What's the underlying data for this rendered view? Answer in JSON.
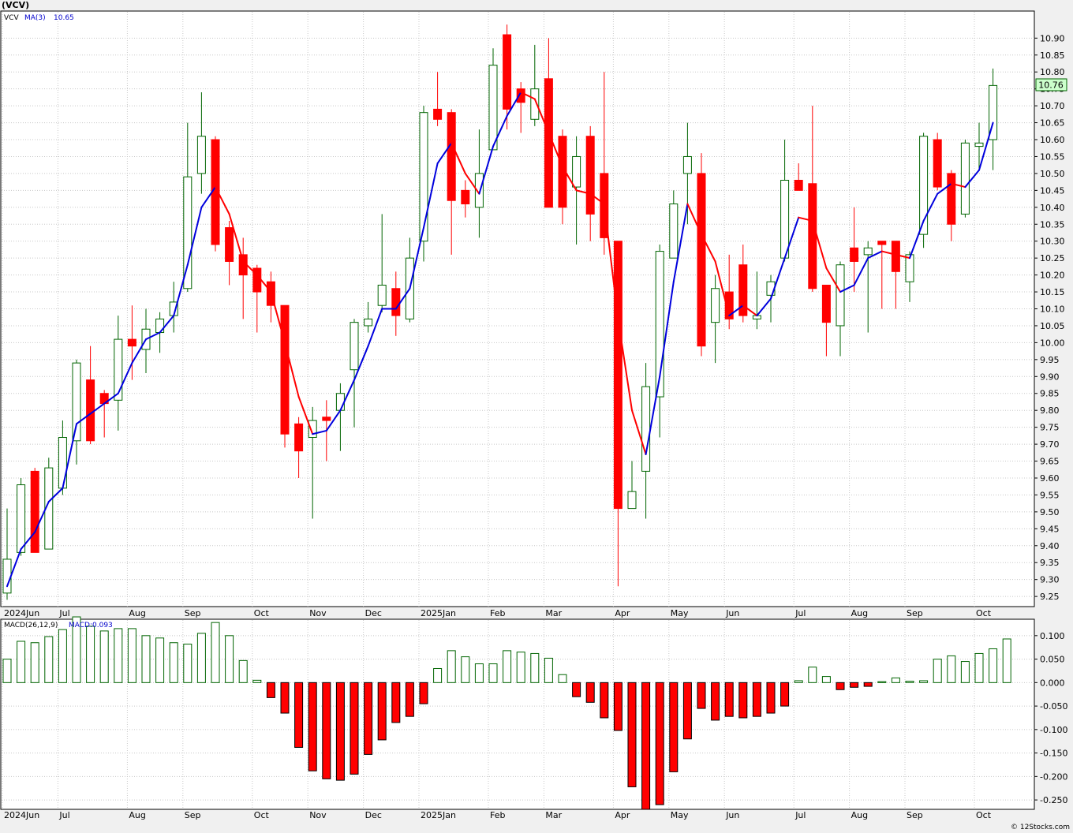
{
  "header": {
    "symbol_title": "(VCV)",
    "legend_symbol": "VCV",
    "ma_label": "MA(3)",
    "ma_value": "10.65",
    "last_price_badge": "10.76",
    "macd_label": "MACD(26,12,9)",
    "macd_value_label": "MACD:0.093",
    "watermark": "© 12Stocks.com"
  },
  "colors": {
    "up": "#006400",
    "down": "#ff0000",
    "ma_up": "#0000dd",
    "ma_down": "#ff0000",
    "grid": "#c8c8c8",
    "badge_bg": "#ccffcc",
    "legend_text": "#0000cc"
  },
  "chart_data": [
    {
      "type": "candlestick",
      "title": "",
      "ylim": [
        9.22,
        10.98
      ],
      "yticks": [
        "10.90",
        "10.85",
        "10.80",
        "10.75",
        "10.70",
        "10.65",
        "10.60",
        "10.55",
        "10.50",
        "10.45",
        "10.40",
        "10.35",
        "10.30",
        "10.25",
        "10.20",
        "10.15",
        "10.10",
        "10.05",
        "10.00",
        "9.95",
        "9.90",
        "9.85",
        "9.80",
        "9.75",
        "9.70",
        "9.65",
        "9.60",
        "9.55",
        "9.50",
        "9.45",
        "9.40",
        "9.35",
        "9.30",
        "9.25"
      ],
      "xticks": [
        {
          "label": "2024Jun",
          "bar": 0
        },
        {
          "label": "Jul",
          "bar": 4
        },
        {
          "label": "Aug",
          "bar": 9
        },
        {
          "label": "Sep",
          "bar": 13
        },
        {
          "label": "Oct",
          "bar": 18
        },
        {
          "label": "Nov",
          "bar": 22
        },
        {
          "label": "Dec",
          "bar": 26
        },
        {
          "label": "2025Jan",
          "bar": 30
        },
        {
          "label": "Feb",
          "bar": 35
        },
        {
          "label": "Mar",
          "bar": 39
        },
        {
          "label": "Apr",
          "bar": 44
        },
        {
          "label": "May",
          "bar": 48
        },
        {
          "label": "Jun",
          "bar": 52
        },
        {
          "label": "Jul",
          "bar": 57
        },
        {
          "label": "Aug",
          "bar": 61
        },
        {
          "label": "Sep",
          "bar": 65
        },
        {
          "label": "Oct",
          "bar": 70
        }
      ],
      "candles": [
        {
          "o": 9.26,
          "h": 9.51,
          "l": 9.24,
          "c": 9.36
        },
        {
          "o": 9.38,
          "h": 9.6,
          "l": 9.37,
          "c": 9.58
        },
        {
          "o": 9.62,
          "h": 9.63,
          "l": 9.38,
          "c": 9.38
        },
        {
          "o": 9.39,
          "h": 9.66,
          "l": 9.39,
          "c": 9.63
        },
        {
          "o": 9.57,
          "h": 9.77,
          "l": 9.55,
          "c": 9.72
        },
        {
          "o": 9.71,
          "h": 9.95,
          "l": 9.64,
          "c": 9.94
        },
        {
          "o": 9.89,
          "h": 9.99,
          "l": 9.7,
          "c": 9.71
        },
        {
          "o": 9.85,
          "h": 9.86,
          "l": 9.72,
          "c": 9.82
        },
        {
          "o": 9.83,
          "h": 10.08,
          "l": 9.74,
          "c": 10.01
        },
        {
          "o": 10.01,
          "h": 10.11,
          "l": 9.89,
          "c": 9.99
        },
        {
          "o": 9.98,
          "h": 10.1,
          "l": 9.91,
          "c": 10.04
        },
        {
          "o": 10.03,
          "h": 10.09,
          "l": 9.97,
          "c": 10.07
        },
        {
          "o": 10.08,
          "h": 10.18,
          "l": 10.03,
          "c": 10.12
        },
        {
          "o": 10.16,
          "h": 10.65,
          "l": 10.15,
          "c": 10.49
        },
        {
          "o": 10.5,
          "h": 10.74,
          "l": 10.44,
          "c": 10.61
        },
        {
          "o": 10.6,
          "h": 10.61,
          "l": 10.27,
          "c": 10.29
        },
        {
          "o": 10.34,
          "h": 10.36,
          "l": 10.17,
          "c": 10.24
        },
        {
          "o": 10.26,
          "h": 10.31,
          "l": 10.07,
          "c": 10.2
        },
        {
          "o": 10.22,
          "h": 10.23,
          "l": 10.03,
          "c": 10.15
        },
        {
          "o": 10.18,
          "h": 10.21,
          "l": 10.06,
          "c": 10.11
        },
        {
          "o": 10.11,
          "h": 10.11,
          "l": 9.69,
          "c": 9.73
        },
        {
          "o": 9.76,
          "h": 9.78,
          "l": 9.6,
          "c": 9.68
        },
        {
          "o": 9.72,
          "h": 9.81,
          "l": 9.48,
          "c": 9.77
        },
        {
          "o": 9.78,
          "h": 9.83,
          "l": 9.65,
          "c": 9.77
        },
        {
          "o": 9.8,
          "h": 9.88,
          "l": 9.68,
          "c": 9.85
        },
        {
          "o": 9.92,
          "h": 10.07,
          "l": 9.75,
          "c": 10.06
        },
        {
          "o": 10.05,
          "h": 10.12,
          "l": 10.03,
          "c": 10.07
        },
        {
          "o": 10.11,
          "h": 10.38,
          "l": 10.09,
          "c": 10.17
        },
        {
          "o": 10.16,
          "h": 10.21,
          "l": 10.02,
          "c": 10.08
        },
        {
          "o": 10.07,
          "h": 10.31,
          "l": 10.06,
          "c": 10.25
        },
        {
          "o": 10.3,
          "h": 10.7,
          "l": 10.24,
          "c": 10.68
        },
        {
          "o": 10.69,
          "h": 10.8,
          "l": 10.64,
          "c": 10.66
        },
        {
          "o": 10.68,
          "h": 10.69,
          "l": 10.26,
          "c": 10.42
        },
        {
          "o": 10.45,
          "h": 10.48,
          "l": 10.37,
          "c": 10.41
        },
        {
          "o": 10.4,
          "h": 10.63,
          "l": 10.31,
          "c": 10.5
        },
        {
          "o": 10.57,
          "h": 10.87,
          "l": 10.57,
          "c": 10.82
        },
        {
          "o": 10.91,
          "h": 10.94,
          "l": 10.63,
          "c": 10.69
        },
        {
          "o": 10.75,
          "h": 10.77,
          "l": 10.62,
          "c": 10.71
        },
        {
          "o": 10.66,
          "h": 10.88,
          "l": 10.64,
          "c": 10.75
        },
        {
          "o": 10.78,
          "h": 10.9,
          "l": 10.45,
          "c": 10.4
        },
        {
          "o": 10.61,
          "h": 10.63,
          "l": 10.35,
          "c": 10.4
        },
        {
          "o": 10.46,
          "h": 10.61,
          "l": 10.29,
          "c": 10.55
        },
        {
          "o": 10.61,
          "h": 10.64,
          "l": 10.3,
          "c": 10.38
        },
        {
          "o": 10.5,
          "h": 10.8,
          "l": 10.26,
          "c": 10.31
        },
        {
          "o": 10.3,
          "h": 10.3,
          "l": 9.28,
          "c": 9.51
        },
        {
          "o": 9.51,
          "h": 9.65,
          "l": 9.51,
          "c": 9.56
        },
        {
          "o": 9.62,
          "h": 9.94,
          "l": 9.48,
          "c": 9.87
        },
        {
          "o": 9.84,
          "h": 10.29,
          "l": 9.72,
          "c": 10.27
        },
        {
          "o": 10.25,
          "h": 10.45,
          "l": 10.25,
          "c": 10.41
        },
        {
          "o": 10.5,
          "h": 10.65,
          "l": 10.35,
          "c": 10.55
        },
        {
          "o": 10.5,
          "h": 10.56,
          "l": 9.96,
          "c": 9.99
        },
        {
          "o": 10.06,
          "h": 10.2,
          "l": 9.94,
          "c": 10.16
        },
        {
          "o": 10.15,
          "h": 10.26,
          "l": 10.04,
          "c": 10.07
        },
        {
          "o": 10.23,
          "h": 10.29,
          "l": 10.06,
          "c": 10.08
        },
        {
          "o": 10.07,
          "h": 10.21,
          "l": 10.04,
          "c": 10.08
        },
        {
          "o": 10.14,
          "h": 10.2,
          "l": 10.06,
          "c": 10.18
        },
        {
          "o": 10.25,
          "h": 10.6,
          "l": 10.24,
          "c": 10.48
        },
        {
          "o": 10.48,
          "h": 10.53,
          "l": 10.45,
          "c": 10.45
        },
        {
          "o": 10.47,
          "h": 10.7,
          "l": 10.15,
          "c": 10.16
        },
        {
          "o": 10.17,
          "h": 10.17,
          "l": 9.96,
          "c": 10.06
        },
        {
          "o": 10.05,
          "h": 10.24,
          "l": 9.96,
          "c": 10.23
        },
        {
          "o": 10.28,
          "h": 10.4,
          "l": 10.15,
          "c": 10.24
        },
        {
          "o": 10.26,
          "h": 10.3,
          "l": 10.03,
          "c": 10.28
        },
        {
          "o": 10.3,
          "h": 10.3,
          "l": 10.1,
          "c": 10.29
        },
        {
          "o": 10.3,
          "h": 10.3,
          "l": 10.1,
          "c": 10.21
        },
        {
          "o": 10.18,
          "h": 10.27,
          "l": 10.12,
          "c": 10.26
        },
        {
          "o": 10.32,
          "h": 10.62,
          "l": 10.28,
          "c": 10.61
        },
        {
          "o": 10.6,
          "h": 10.62,
          "l": 10.45,
          "c": 10.46
        },
        {
          "o": 10.5,
          "h": 10.51,
          "l": 10.3,
          "c": 10.35
        },
        {
          "o": 10.38,
          "h": 10.6,
          "l": 10.37,
          "c": 10.59
        },
        {
          "o": 10.58,
          "h": 10.65,
          "l": 10.51,
          "c": 10.59
        },
        {
          "o": 10.6,
          "h": 10.81,
          "l": 10.51,
          "c": 10.76
        }
      ],
      "ma3": [
        9.28,
        9.39,
        9.44,
        9.53,
        9.57,
        9.76,
        9.79,
        9.82,
        9.85,
        9.94,
        10.01,
        10.03,
        10.08,
        10.23,
        10.4,
        10.46,
        10.38,
        10.24,
        10.2,
        10.15,
        10.0,
        9.84,
        9.73,
        9.74,
        9.8,
        9.89,
        9.99,
        10.1,
        10.1,
        10.16,
        10.34,
        10.53,
        10.59,
        10.5,
        10.44,
        10.58,
        10.67,
        10.74,
        10.72,
        10.62,
        10.52,
        10.45,
        10.44,
        10.41,
        10.07,
        9.8,
        9.67,
        9.9,
        10.18,
        10.41,
        10.32,
        10.24,
        10.08,
        10.11,
        10.08,
        10.13,
        10.25,
        10.37,
        10.36,
        10.22,
        10.15,
        10.17,
        10.25,
        10.27,
        10.26,
        10.25,
        10.36,
        10.44,
        10.47,
        10.46,
        10.51,
        10.65
      ]
    },
    {
      "type": "bar",
      "title": "",
      "ylim": [
        -0.27,
        0.135
      ],
      "yticks": [
        "0.100",
        "0.050",
        "0.000",
        "-0.050",
        "-0.100",
        "-0.150",
        "-0.200",
        "-0.250"
      ],
      "values": [
        0.05,
        0.088,
        0.085,
        0.098,
        0.113,
        0.14,
        0.12,
        0.11,
        0.115,
        0.115,
        0.1,
        0.095,
        0.085,
        0.082,
        0.105,
        0.128,
        0.1,
        0.047,
        0.005,
        -0.032,
        -0.065,
        -0.138,
        -0.188,
        -0.205,
        -0.208,
        -0.195,
        -0.153,
        -0.122,
        -0.085,
        -0.072,
        -0.045,
        0.03,
        0.068,
        0.055,
        0.04,
        0.04,
        0.068,
        0.065,
        0.062,
        0.052,
        0.017,
        -0.03,
        -0.042,
        -0.075,
        -0.102,
        -0.222,
        -0.27,
        -0.26,
        -0.19,
        -0.12,
        -0.055,
        -0.08,
        -0.072,
        -0.075,
        -0.072,
        -0.065,
        -0.05,
        0.004,
        0.033,
        0.013,
        -0.015,
        -0.01,
        -0.008,
        0.002,
        0.01,
        0.003,
        0.004,
        0.05,
        0.057,
        0.045,
        0.062,
        0.072,
        0.093
      ]
    }
  ]
}
